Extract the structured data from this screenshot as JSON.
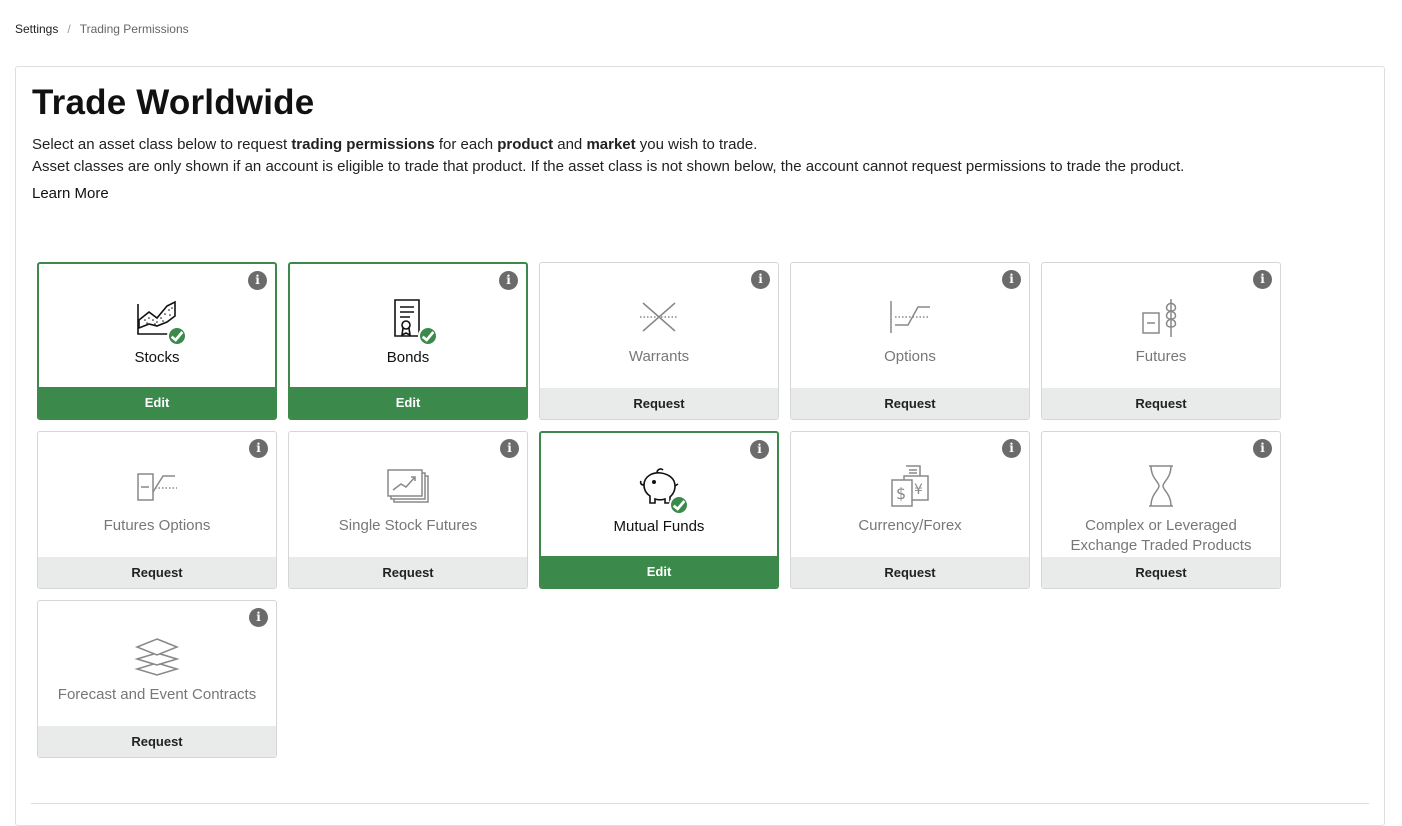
{
  "breadcrumb": {
    "root": "Settings",
    "separator": "/",
    "current": "Trading Permissions"
  },
  "page": {
    "title": "Trade Worldwide",
    "line1": {
      "t1": "Select an asset class below to request ",
      "b1": "trading permissions",
      "t2": " for each ",
      "b2": "product",
      "t3": " and ",
      "b3": "market",
      "t4": " you wish to trade."
    },
    "line2": "Asset classes are only shown if an account is eligible to trade that product. If the asset class is not shown below, the account cannot request permissions to trade the product.",
    "learn_more": "Learn More"
  },
  "colors": {
    "accent": "#3b8a4c",
    "footer_gray": "#e9ebea",
    "info": "#6b6b6b"
  },
  "cards": [
    {
      "label": "Stocks",
      "action": "Edit",
      "enabled": true,
      "icon": "stocks-icon"
    },
    {
      "label": "Bonds",
      "action": "Edit",
      "enabled": true,
      "icon": "bonds-icon"
    },
    {
      "label": "Warrants",
      "action": "Request",
      "enabled": false,
      "icon": "warrants-icon"
    },
    {
      "label": "Options",
      "action": "Request",
      "enabled": false,
      "icon": "options-icon"
    },
    {
      "label": "Futures",
      "action": "Request",
      "enabled": false,
      "icon": "futures-icon"
    },
    {
      "label": "Futures Options",
      "action": "Request",
      "enabled": false,
      "icon": "futures-options-icon"
    },
    {
      "label": "Single Stock Futures",
      "action": "Request",
      "enabled": false,
      "icon": "single-stock-futures-icon"
    },
    {
      "label": "Mutual Funds",
      "action": "Edit",
      "enabled": true,
      "icon": "piggy-bank-icon"
    },
    {
      "label": "Currency/Forex",
      "action": "Request",
      "enabled": false,
      "icon": "currency-icon"
    },
    {
      "label_line1": "Complex or Leveraged",
      "label_line2": "Exchange Traded Products",
      "action": "Request",
      "enabled": false,
      "icon": "hourglass-icon"
    },
    {
      "label": "Forecast and Event Contracts",
      "action": "Request",
      "enabled": false,
      "icon": "layers-icon"
    }
  ],
  "info_glyph": "i"
}
